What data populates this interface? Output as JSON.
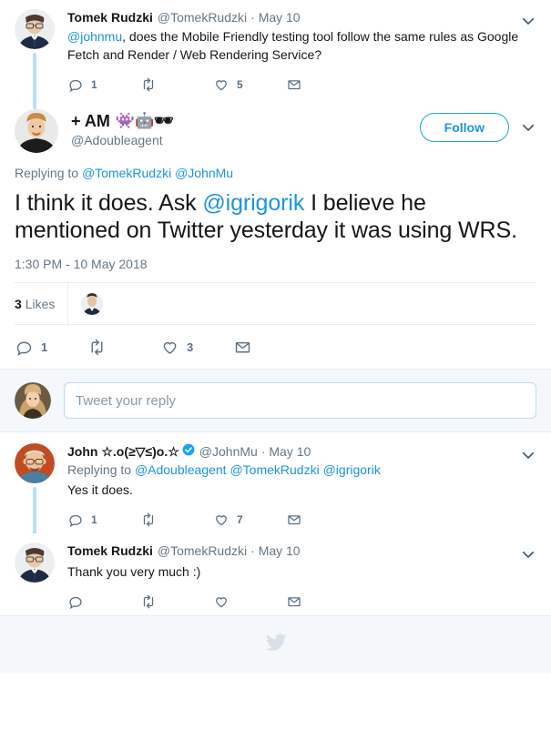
{
  "theme": {
    "link_color": "#1b95e0",
    "accent_color": "#1da1f2",
    "muted_color": "#657786",
    "icon_color": "#5b7083",
    "thread_line_color": "#b8dffa",
    "compose_bg": "#f5f8fa",
    "border_color": "#e6ecf0"
  },
  "parent_tweet": {
    "display_name": "Tomek Rudzki",
    "handle": "@TomekRudzki",
    "separator": "·",
    "timestamp": "May 10",
    "mention_prefix": "@johnmu",
    "text": ", does the Mobile Friendly testing tool follow the same rules as Google Fetch and Render / Web Rendering Service?",
    "actions": {
      "reply_count": "1",
      "retweet_count": "",
      "like_count": "5",
      "dm_count": ""
    }
  },
  "main_tweet": {
    "display_name": "+ AM",
    "name_emoji": "👾🤖🕶",
    "handle": "@Adoubleagent",
    "follow_label": "Follow",
    "replying_to_label": "Replying to",
    "replying_to_mentions": [
      "@TomekRudzki",
      "@JohnMu"
    ],
    "text_part_1": "I think it does. Ask ",
    "text_mention": "@igrigorik",
    "text_part_2": " I believe he mentioned on Twitter yesterday it was using WRS.",
    "timestamp": "1:30 PM - 10 May 2018",
    "likes_count": "3",
    "likes_label": "Likes",
    "actions": {
      "reply_count": "1",
      "retweet_count": "",
      "like_count": "3",
      "dm_count": ""
    }
  },
  "compose": {
    "placeholder": "Tweet your reply"
  },
  "replies": [
    {
      "display_name": "John ☆.o(≥▽≤)o.☆",
      "verified": true,
      "handle": "@JohnMu",
      "separator": "·",
      "timestamp": "May 10",
      "replying_to_label": "Replying to",
      "replying_to_mentions": [
        "@Adoubleagent",
        "@TomekRudzki",
        "@igrigorik"
      ],
      "text": "Yes it does.",
      "actions": {
        "reply_count": "1",
        "retweet_count": "",
        "like_count": "7",
        "dm_count": ""
      }
    },
    {
      "display_name": "Tomek Rudzki",
      "verified": false,
      "handle": "@TomekRudzki",
      "separator": "·",
      "timestamp": "May 10",
      "replying_to_label": "",
      "replying_to_mentions": [],
      "text": "Thank you very much :)",
      "actions": {
        "reply_count": "",
        "retweet_count": "",
        "like_count": "",
        "dm_count": ""
      }
    }
  ],
  "footer": {
    "logo": "twitter-bird-logo"
  }
}
